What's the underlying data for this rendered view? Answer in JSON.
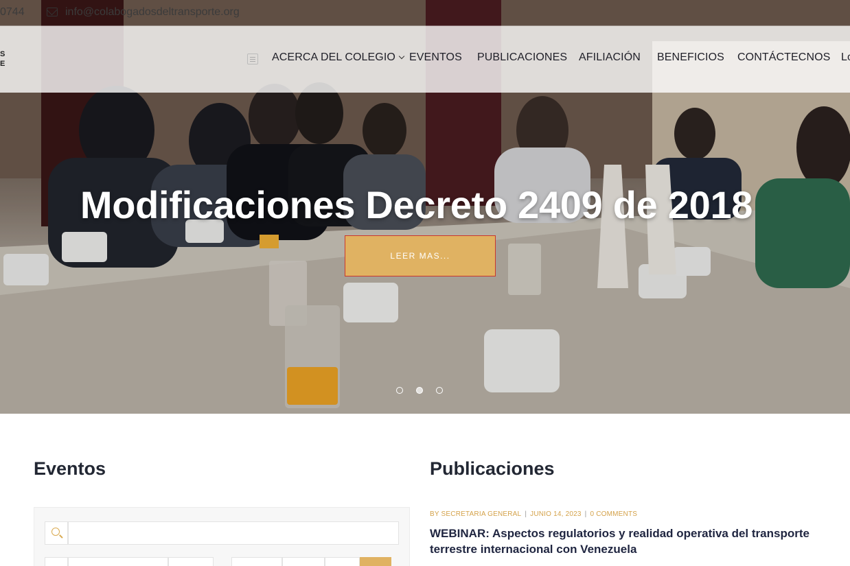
{
  "topbar": {
    "phone_fragment": "0744",
    "email": "info@colabogados del transporte.org",
    "email_icon": "envelope-icon"
  },
  "logo": {
    "fragment": "S\nE"
  },
  "nav": {
    "items": [
      {
        "label": "ACERCA DEL COLEGIO",
        "has_dropdown": true
      },
      {
        "label": "EVENTOS"
      },
      {
        "label": "PUBLICACIONES"
      },
      {
        "label": "AFILIACIÓN"
      },
      {
        "label": "BENEFICIOS"
      },
      {
        "label": "CONTÁCTECNOS"
      },
      {
        "label": "Lo"
      }
    ]
  },
  "hero": {
    "title": "Modificaciones Decreto 2409 de 2018",
    "button_label": "LEER MAS...",
    "slides_total": 3,
    "active_slide": 2,
    "accent": "#e0b262"
  },
  "events": {
    "title": "Eventos",
    "search_placeholder": ""
  },
  "publications": {
    "title": "Publicaciones",
    "post": {
      "author": "BY SECRETARIA GENERAL",
      "date": "JUNIO 14, 2023",
      "comments": "0 COMMENTS",
      "title": "WEBINAR: Aspectos regulatorios y realidad operativa del transporte terrestre internacional con Venezuela"
    }
  },
  "colors": {
    "accent": "#e0b262",
    "heading": "#222733",
    "meta": "#d4a24a"
  }
}
